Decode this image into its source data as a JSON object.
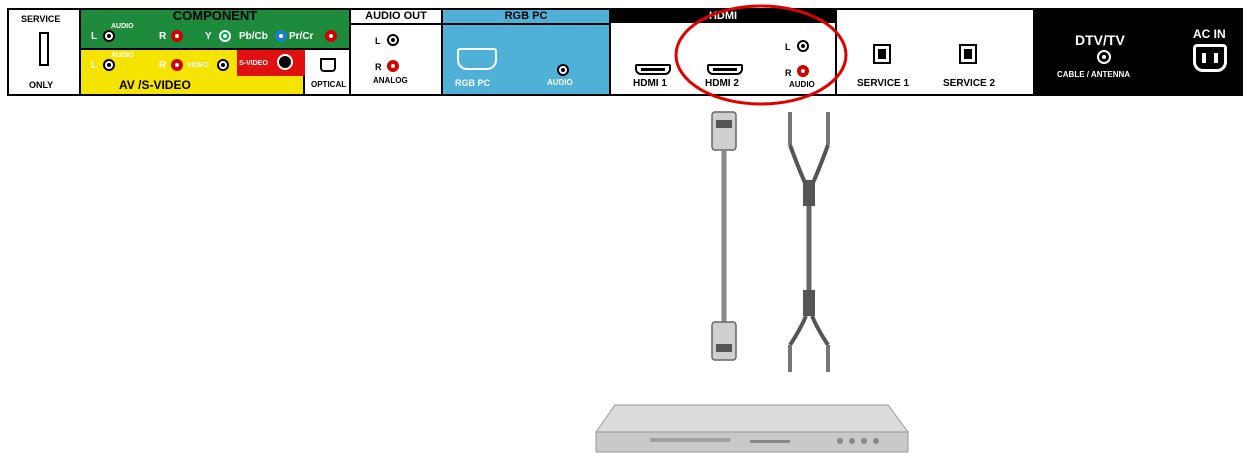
{
  "panel": {
    "service": {
      "top": "SERVICE",
      "bottom": "ONLY"
    },
    "component": {
      "title": "COMPONENT",
      "audio": "AUDIO",
      "l": "L",
      "r": "R",
      "y": "Y",
      "pbcb": "Pb/Cb",
      "prcr": "Pr/Cr"
    },
    "av": {
      "audio": "AUDIO",
      "l": "L",
      "r": "R",
      "video": "VIDEO",
      "svideo": "S-VIDEO",
      "title": "AV /S-VIDEO"
    },
    "optical": "OPTICAL",
    "audio_out": {
      "title": "AUDIO  OUT",
      "l": "L",
      "r": "R",
      "analog": "ANALOG"
    },
    "rgb": {
      "title": "RGB  PC",
      "port": "RGB PC",
      "audio": "AUDIO"
    },
    "hdmi": {
      "title": "HDMI",
      "hdmi1": "HDMI 1",
      "hdmi2": "HDMI 2",
      "l": "L",
      "r": "R",
      "audio": "AUDIO"
    },
    "service1": "SERVICE 1",
    "service2": "SERVICE 2",
    "dtv": {
      "title": "DTV/TV",
      "sub": "CABLE / ANTENNA"
    },
    "ac": "AC  IN"
  },
  "colors": {
    "component_green": "#1e8a3c",
    "av_yellow": "#f5e400",
    "svideo_red": "#e01010",
    "rgb_blue": "#4fb0d8",
    "dark": "#000000",
    "highlight": "#e00000"
  },
  "icons": [
    "usb-port-icon",
    "rca-jack-icon",
    "svideo-port-icon",
    "optical-port-icon",
    "vga-port-icon",
    "hdmi-port-icon",
    "ethernet-port-icon",
    "coax-port-icon",
    "power-socket-icon"
  ]
}
